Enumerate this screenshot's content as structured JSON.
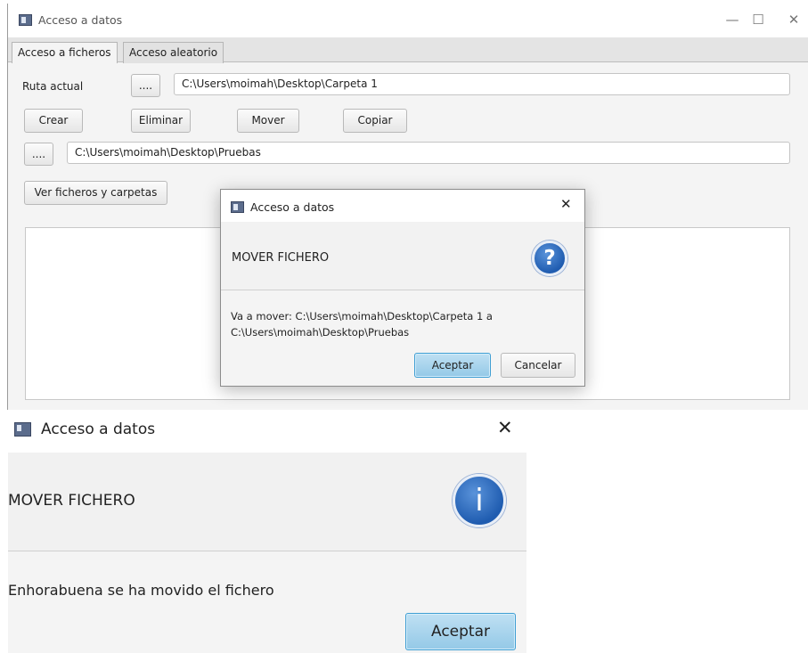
{
  "main_window": {
    "title": "Acceso a datos",
    "caption_buttons": {
      "minimize": "—",
      "maximize": "☐",
      "close": "✕"
    },
    "tabs": [
      {
        "label": "Acceso a ficheros",
        "active": true
      },
      {
        "label": "Acceso aleatorio",
        "active": false
      }
    ],
    "ruta_label": "Ruta actual",
    "browse_label_1": "....",
    "ruta_value": "C:\\Users\\moimah\\Desktop\\Carpeta 1",
    "actions": {
      "crear": "Crear",
      "eliminar": "Eliminar",
      "mover": "Mover",
      "copiar": "Copiar"
    },
    "browse_label_2": "....",
    "destino_value": "C:\\Users\\moimah\\Desktop\\Pruebas",
    "ver_button": "Ver ficheros y carpetas"
  },
  "confirm_dialog": {
    "title": "Acceso a datos",
    "close_glyph": "✕",
    "header": "MOVER FICHERO",
    "icon": "question-icon",
    "icon_glyph": "?",
    "message_line1": "Va a mover: C:\\Users\\moimah\\Desktop\\Carpeta 1 a",
    "message_line2": "C:\\Users\\moimah\\Desktop\\Pruebas",
    "accept": "Aceptar",
    "cancel": "Cancelar"
  },
  "info_dialog": {
    "title": "Acceso a datos",
    "close_glyph": "✕",
    "header": "MOVER FICHERO",
    "icon": "info-icon",
    "icon_glyph": "i",
    "message": "Enhorabuena se ha movido el fichero",
    "accept": "Aceptar"
  },
  "colors": {
    "accent_blue": "#1f5cb0",
    "default_button": "#94c9e7",
    "window_bg": "#f4f4f4"
  }
}
